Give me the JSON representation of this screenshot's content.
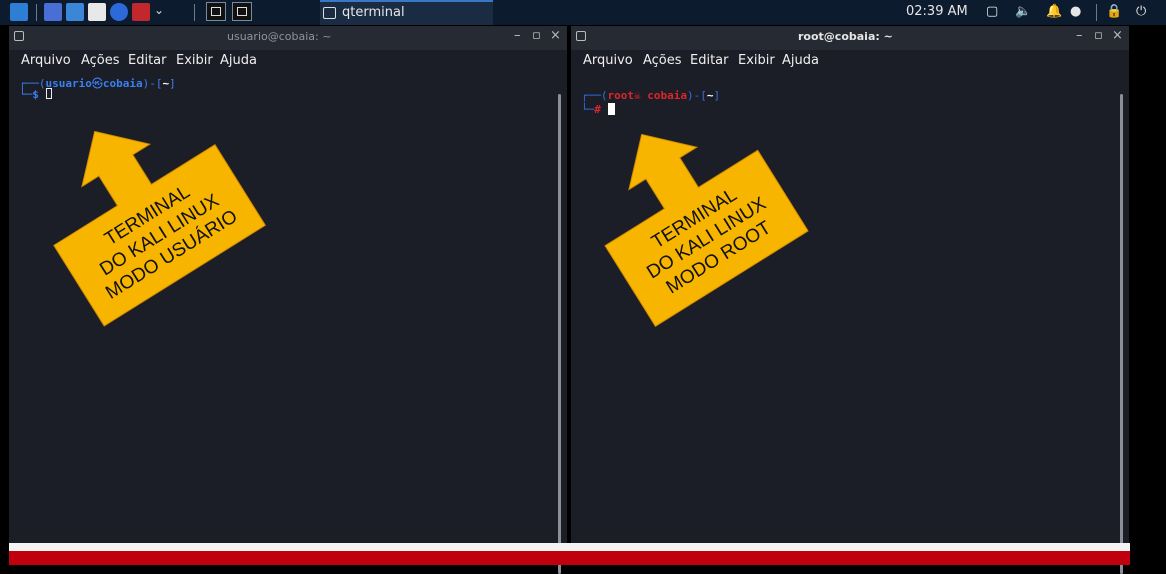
{
  "panel": {
    "task_title": "qterminal",
    "clock": "02:39 AM"
  },
  "left_window": {
    "title": "usuario@cobaia: ~",
    "menu": [
      "Arquivo",
      "Ações",
      "Editar",
      "Exibir",
      "Ajuda"
    ],
    "prompt_user": "usuario",
    "prompt_host": "cobaia",
    "prompt_dir": "~",
    "prompt_symbol": "$"
  },
  "right_window": {
    "title": "root@cobaia: ~",
    "menu": [
      "Arquivo",
      "Ações",
      "Editar",
      "Exibir",
      "Ajuda"
    ],
    "prompt_user": "root",
    "prompt_host": "cobaia",
    "prompt_dir": "~",
    "prompt_symbol": "#"
  },
  "annotations": {
    "left": [
      "TERMINAL",
      "DO KALI LINUX",
      "MODO USUÁRIO"
    ],
    "right": [
      "TERMINAL",
      "DO KALI LINUX",
      "MODO ROOT"
    ]
  },
  "colors": {
    "panel_bg": "#0d1b2e",
    "window_bg": "#1b1e26",
    "user_prompt": "#3b7ff0",
    "root_prompt": "#e0242c",
    "annotation": "#f7b500",
    "bottom_bar": "#c0000c"
  }
}
